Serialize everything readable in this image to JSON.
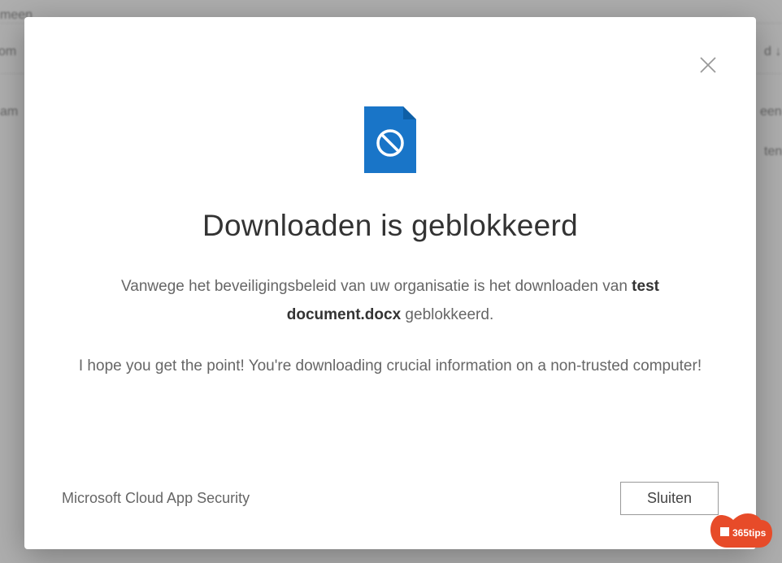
{
  "background": {
    "text1": "meen",
    "text2": "om",
    "text3": "am",
    "text4": "d ↓",
    "text5": "een",
    "text6": "ten"
  },
  "modal": {
    "title": "Downloaden is geblokkeerd",
    "subtitle_prefix": "Vanwege het beveiligingsbeleid van uw organisatie is het downloaden van ",
    "subtitle_filename": "test document.docx",
    "subtitle_suffix": " geblokkeerd.",
    "message": "I hope you get the point! You're downloading crucial information on a non-trusted computer!",
    "footer_text": "Microsoft Cloud App Security",
    "close_button": "Sluiten"
  },
  "watermark": {
    "text": "365tips"
  },
  "colors": {
    "icon_blue": "#1975C8",
    "icon_blue_dark": "#0E5FA6",
    "watermark_orange": "#E74B29"
  }
}
